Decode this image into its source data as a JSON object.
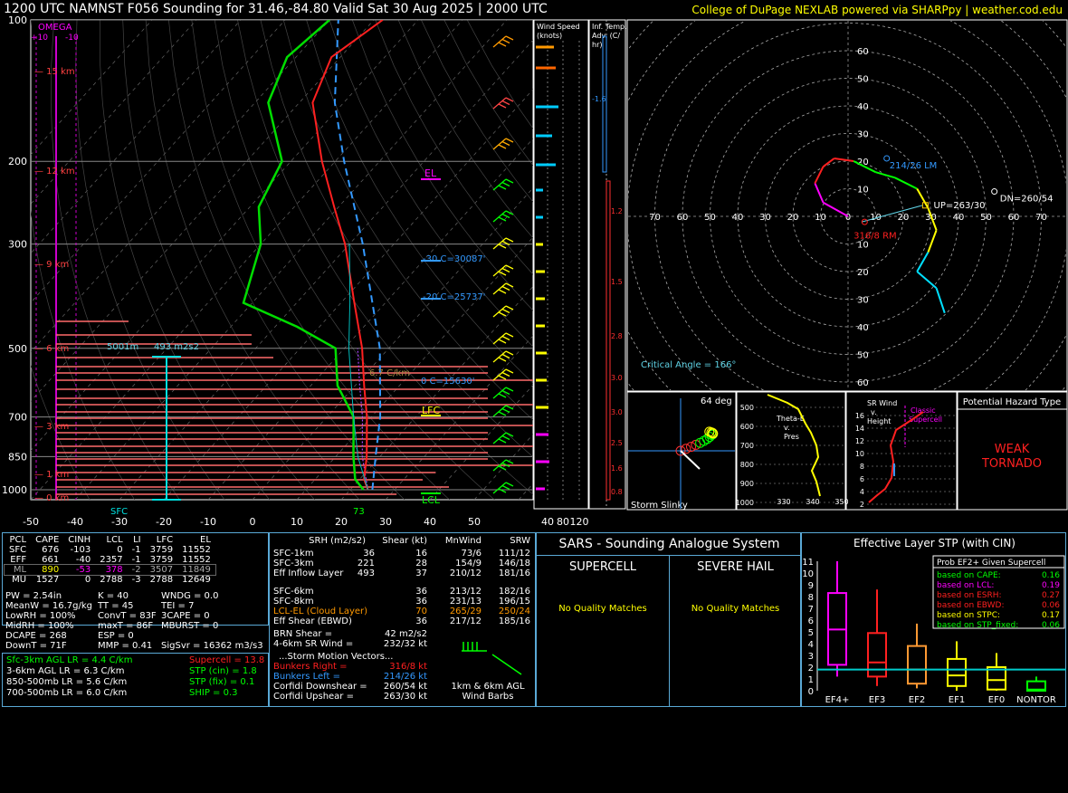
{
  "header": {
    "title": "1200 UTC NAMNST F056 Sounding for 31.46,-84.80 Valid  Sat 30 Aug 2025 | 2000 UTC",
    "credit": "College of DuPage NEXLAB powered via SHARPpy | weather.cod.edu"
  },
  "chart_data": [
    {
      "type": "line",
      "name": "skew-t",
      "pressure_ticks": [
        "100",
        "200",
        "300",
        "500",
        "700",
        "850",
        "1000"
      ],
      "temp_ticks": [
        "-50",
        "-40",
        "-30",
        "-20",
        "-10",
        "0",
        "10",
        "20",
        "30",
        "40",
        "50"
      ],
      "height_labels": [
        "15 km",
        "12 km",
        "9 km",
        "6 km",
        "3 km",
        "1 km",
        "0 km"
      ],
      "sfc_label": "SFC",
      "sfc_temp": "73",
      "omega_label": "OMEGA",
      "omega_plus": "+10",
      "omega_minus": "-10",
      "levels": {
        "el": "EL",
        "lfc": "LFC",
        "lcl": "LCL"
      },
      "annotations": [
        "-30 C=30087'",
        "-20 C=25737'",
        "0 C=15630'",
        "6.7 C/km",
        "5001m",
        "493 m2s2"
      ],
      "temperature_profile": [
        {
          "p": 1000,
          "t": 24
        },
        {
          "p": 950,
          "t": 21
        },
        {
          "p": 850,
          "t": 17
        },
        {
          "p": 700,
          "t": 9
        },
        {
          "p": 600,
          "t": 2
        },
        {
          "p": 500,
          "t": -6
        },
        {
          "p": 400,
          "t": -17
        },
        {
          "p": 300,
          "t": -31
        },
        {
          "p": 250,
          "t": -41
        },
        {
          "p": 200,
          "t": -53
        },
        {
          "p": 150,
          "t": -67
        },
        {
          "p": 120,
          "t": -72
        },
        {
          "p": 100,
          "t": -68
        }
      ],
      "dewpoint_profile": [
        {
          "p": 1000,
          "t": 23
        },
        {
          "p": 950,
          "t": 19
        },
        {
          "p": 850,
          "t": 14
        },
        {
          "p": 700,
          "t": 6
        },
        {
          "p": 600,
          "t": -4
        },
        {
          "p": 500,
          "t": -12
        },
        {
          "p": 450,
          "t": -25
        },
        {
          "p": 400,
          "t": -42
        },
        {
          "p": 300,
          "t": -50
        },
        {
          "p": 250,
          "t": -58
        },
        {
          "p": 200,
          "t": -62
        },
        {
          "p": 150,
          "t": -77
        },
        {
          "p": 120,
          "t": -82
        },
        {
          "p": 100,
          "t": -80
        }
      ]
    },
    {
      "type": "line",
      "name": "hodograph",
      "rings": [
        "10",
        "20",
        "30",
        "40",
        "50",
        "60"
      ],
      "axis_labels": [
        "70",
        "60",
        "50",
        "40",
        "30",
        "20",
        "10",
        "0",
        "10",
        "20",
        "30",
        "40",
        "50",
        "60",
        "70"
      ],
      "labels": [
        "214/26 LM",
        "316/8 RM",
        "UP=263/30",
        "DN=260/54",
        "Critical Angle = 166°"
      ],
      "trace": [
        {
          "u": 0,
          "v": 0
        },
        {
          "u": -9,
          "v": 5
        },
        {
          "u": -12,
          "v": 12
        },
        {
          "u": -9,
          "v": 18
        },
        {
          "u": -5,
          "v": 21
        },
        {
          "u": 2,
          "v": 20
        },
        {
          "u": 10,
          "v": 16
        },
        {
          "u": 17,
          "v": 14
        },
        {
          "u": 25,
          "v": 10
        },
        {
          "u": 29,
          "v": 3
        },
        {
          "u": 32,
          "v": -5
        },
        {
          "u": 29,
          "v": -13
        },
        {
          "u": 25,
          "v": -20
        },
        {
          "u": 32,
          "v": -26
        },
        {
          "u": 35,
          "v": -35
        }
      ]
    },
    {
      "type": "bar",
      "name": "effective-layer-stp",
      "title": "Effective Layer STP (with CIN)",
      "categories": [
        "EF4+",
        "EF3",
        "EF2",
        "EF1",
        "EF0",
        "NONTOR"
      ],
      "yticks": [
        "0",
        "1",
        "2",
        "3",
        "4",
        "5",
        "6",
        "7",
        "8",
        "9",
        "10",
        "11"
      ],
      "boxes": [
        {
          "lo": 1.2,
          "q1": 2.2,
          "med": 5.2,
          "q3": 8.3,
          "hi": 11
        },
        {
          "lo": 0.4,
          "q1": 1.2,
          "med": 2.4,
          "q3": 4.9,
          "hi": 8.6
        },
        {
          "lo": 0.2,
          "q1": 0.6,
          "med": 1.8,
          "q3": 3.8,
          "hi": 5.7
        },
        {
          "lo": 0.0,
          "q1": 0.4,
          "med": 1.3,
          "q3": 2.7,
          "hi": 4.2
        },
        {
          "lo": 0.0,
          "q1": 0.1,
          "med": 0.9,
          "q3": 2.0,
          "hi": 3.2
        },
        {
          "lo": 0.0,
          "q1": 0.0,
          "med": 0.1,
          "q3": 0.8,
          "hi": 1.2
        }
      ],
      "observed_value": 1.8
    }
  ],
  "panels": {
    "wind_speed": {
      "title": "Wind Speed (knots)",
      "ticks": [
        "40",
        "80",
        "120"
      ]
    },
    "inf_temp": {
      "title": "Inf. Temp. Adv. (C/ hr)",
      "values": [
        "-1.6",
        "1.2",
        "1.5",
        "2.8",
        "3.0",
        "3.0",
        "2.5",
        "1.6",
        "0.8"
      ]
    },
    "slinky": {
      "angle": "64 deg",
      "label": "Storm Slinky"
    },
    "thetae": {
      "labels": [
        "Theta-E",
        "v.",
        "Pres"
      ],
      "ticks": [
        "500",
        "600",
        "700",
        "800",
        "900",
        "1000"
      ],
      "xticks": [
        "330",
        "340",
        "350"
      ]
    },
    "srwind": {
      "labels": [
        "SR Wind",
        "v.",
        "Height",
        "Classic",
        "Supercell"
      ],
      "ticks": [
        "16",
        "14",
        "12",
        "10",
        "8",
        "6",
        "4",
        "2"
      ]
    },
    "hazard": {
      "title": "Potential Hazard Type",
      "value": "WEAK\nTORNADO"
    }
  },
  "parcel_table": {
    "headers": [
      "PCL",
      "CAPE",
      "CINH",
      "LCL",
      "LI",
      "LFC",
      "EL"
    ],
    "rows": [
      [
        "SFC",
        "676",
        "-103",
        "0",
        "-1",
        "3759",
        "11552"
      ],
      [
        "EFF",
        "661",
        "-40",
        "2357",
        "-1",
        "3759",
        "11552"
      ],
      [
        "ML",
        "890",
        "-53",
        "378",
        "-2",
        "3507",
        "11849"
      ],
      [
        "MU",
        "1527",
        "0",
        "2788",
        "-3",
        "2788",
        "12649"
      ]
    ]
  },
  "indices": [
    [
      "PW = 2.54in",
      "K = 40",
      "WNDG = 0.0"
    ],
    [
      "MeanW = 16.7g/kg",
      "TT = 45",
      "TEI = 7"
    ],
    [
      "LowRH = 100%",
      "ConvT = 83F",
      "3CAPE = 0"
    ],
    [
      "MidRH = 100%",
      "maxT = 86F",
      "MBURST = 0"
    ],
    [
      "DCAPE = 268",
      "ESP = 0",
      ""
    ],
    [
      "DownT = 71F",
      "MMP = 0.41",
      "SigSvr = 16362 m3/s3"
    ]
  ],
  "lapse_rates": [
    "Sfc-3km AGL LR = 4.4 C/km",
    "3-6km AGL LR = 6.3 C/km",
    "850-500mb LR = 5.6 C/km",
    "700-500mb LR = 6.0 C/km"
  ],
  "composite": [
    "Supercell = 13.8",
    "STP (cin) = 1.8",
    "STP (fix) = 0.1",
    "SHIP = 0.3"
  ],
  "kinematics": {
    "headers": [
      "SRH (m2/s2)",
      "Shear (kt)",
      "MnWind",
      "SRW"
    ],
    "rows": [
      [
        "SFC-1km",
        "36",
        "16",
        "73/6",
        "111/12"
      ],
      [
        "SFC-3km",
        "221",
        "28",
        "154/9",
        "146/18"
      ],
      [
        "Eff Inflow Layer",
        "493",
        "37",
        "210/12",
        "181/16"
      ],
      [
        "",
        "",
        "",
        "",
        ""
      ],
      [
        "SFC-6km",
        "36",
        "213/12",
        "182/16",
        ""
      ],
      [
        "SFC-8km",
        "36",
        "231/13",
        "196/15",
        ""
      ],
      [
        "LCL-EL (Cloud Layer)",
        "70",
        "265/29",
        "250/24",
        ""
      ],
      [
        "Eff Shear (EBWD)",
        "36",
        "217/12",
        "185/16",
        ""
      ]
    ],
    "brn": [
      "BRN Shear =",
      "42 m2/s2"
    ],
    "srwind46": [
      "4-6km SR Wind =",
      "232/32 kt"
    ],
    "storm_header": "...Storm Motion Vectors...",
    "storm": [
      [
        "Bunkers Right =",
        "316/8 kt"
      ],
      [
        "Bunkers Left =",
        "214/26 kt"
      ],
      [
        "Corfidi Downshear =",
        "260/54 kt"
      ],
      [
        "Corfidi Upshear =",
        "263/30 kt"
      ]
    ],
    "barbs_label": "1km & 6km AGL Wind Barbs"
  },
  "sars": {
    "title": "SARS - Sounding Analogue System",
    "supercell": "SUPERCELL",
    "hail": "SEVERE HAIL",
    "no_match": "No Quality Matches"
  },
  "prob": {
    "title": "Prob EF2+ Given Supercell",
    "rows": [
      {
        "label": "based on CAPE:",
        "value": "0.16",
        "color": "#00ff00"
      },
      {
        "label": "based on LCL:",
        "value": "0.19",
        "color": "#ff00ff"
      },
      {
        "label": "based on ESRH:",
        "value": "0.27",
        "color": "#ff2020"
      },
      {
        "label": "based on EBWD:",
        "value": "0.06",
        "color": "#ff2020"
      },
      {
        "label": "based on STPC:",
        "value": "0.17",
        "color": "#ffff00"
      },
      {
        "label": "based on STP_fixed:",
        "value": "0.06",
        "color": "#00ff00"
      }
    ]
  }
}
